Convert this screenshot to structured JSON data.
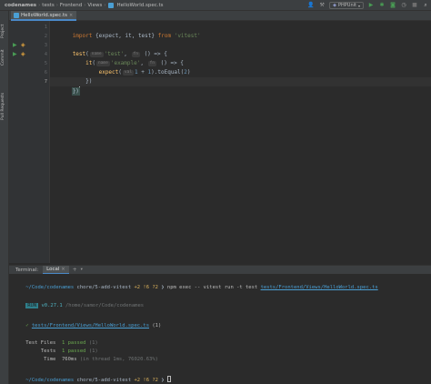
{
  "nav": {
    "crumbs": [
      "codenames",
      "tests",
      "Frontend",
      "Views"
    ],
    "file": "HelloWorld.spec.ts",
    "run_config": "PHPUnit"
  },
  "left_tabs": {
    "project": "Project",
    "commit": "Commit",
    "pull_requests": "Pull Requests"
  },
  "editor": {
    "tab_label": "HelloWorld.spec.ts",
    "line_numbers": [
      "1",
      "2",
      "3",
      "4",
      "5",
      "6",
      "7"
    ],
    "line1": {
      "kw1": "import",
      "body": " {expect, it, test} ",
      "kw2": "from",
      "str": "'vitest'"
    },
    "line3": {
      "fn": "test",
      "hint1": "name",
      "str": "'test'",
      "hint2": "fn",
      "rest": " () => {"
    },
    "line4": {
      "fn": "it",
      "hint1": "name",
      "str": "'example'",
      "hint2": "fn",
      "rest": " () => {"
    },
    "line5": {
      "fn": "expect",
      "hint1": "val",
      "n1": "1",
      "plus": " + ",
      "n2": "1",
      "mid": ").toEqual(",
      "n3": "2",
      "end": ")"
    },
    "line6": "})",
    "line7": "})"
  },
  "terminal": {
    "title": "Terminal:",
    "tab": "Local",
    "prompt_dir": "~/Code/codenames",
    "prompt_branch": "chore/5-add-vitest",
    "prompt_status": "+2 !6 ?2",
    "prompt_arrow": "❯",
    "command": "npm exec -- vitest run -t test",
    "command_path": "tests/Frontend/Views/HelloWorld.spec.ts",
    "run_badge": "RUN",
    "version": "v0.27.1",
    "cwd": "/home/samor/Code/codenames",
    "result_check": "✓",
    "result_file": "tests/Frontend/Views/HelloWorld.spec.ts",
    "result_count": "(1)",
    "files_label": "Test Files",
    "files_passed": "1 passed",
    "files_total": "(1)",
    "tests_label": "Tests",
    "tests_passed": "1 passed",
    "tests_total": "(1)",
    "time_label": "Time",
    "time_value": "760ms",
    "time_detail": "(in thread 1ms, 76020.63%)"
  },
  "colors": {
    "keyword": "#cc7832",
    "function": "#ffc66d",
    "string": "#6a8759",
    "number": "#6897bb",
    "link": "#4a9fd4",
    "passed": "#6aa84f"
  }
}
